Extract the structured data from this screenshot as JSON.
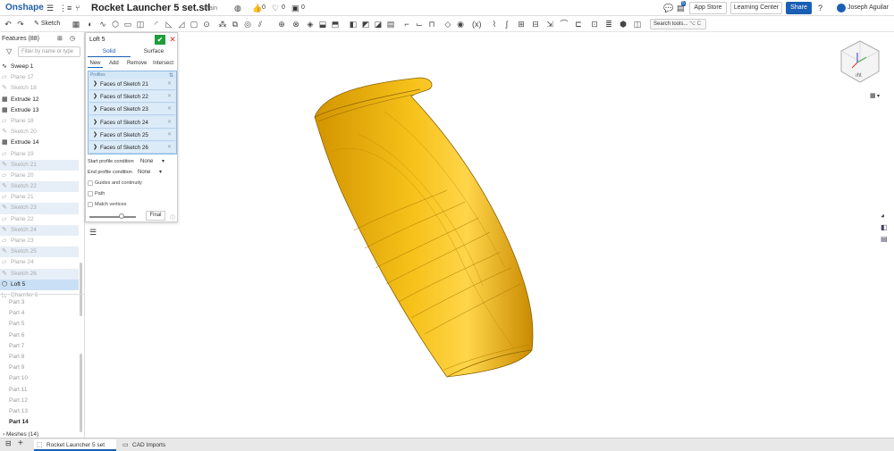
{
  "app": {
    "logo": "Onshape",
    "title": "Rocket Launcher 5 set.stl",
    "branch": "Main"
  },
  "header": {
    "likes": "0",
    "comments": "0",
    "doc_count": "0",
    "notif_count": "5",
    "app_store": "App Store",
    "learning_center": "Learning Center",
    "share": "Share",
    "user": "Joseph Aguilar",
    "help": "?"
  },
  "toolbar": {
    "sketch_label": "Sketch",
    "search_tools": "Search tools...",
    "shortcut": "⌥ C"
  },
  "features": {
    "title": "Features (88)",
    "filter_placeholder": "Filter by name or type",
    "items": [
      {
        "label": "Sweep 1",
        "icon": "sweep-icon",
        "state": "active"
      },
      {
        "label": "Plane 17",
        "icon": "plane-icon",
        "state": "dim"
      },
      {
        "label": "Sketch 18",
        "icon": "sketch-icon",
        "state": "dim"
      },
      {
        "label": "Extrude 12",
        "icon": "extrude-icon",
        "state": "active"
      },
      {
        "label": "Extrude 13",
        "icon": "extrude-icon",
        "state": "active"
      },
      {
        "label": "Plane 18",
        "icon": "plane-icon",
        "state": "dim"
      },
      {
        "label": "Sketch 20",
        "icon": "sketch-icon",
        "state": "dim"
      },
      {
        "label": "Extrude 14",
        "icon": "extrude-icon",
        "state": "active"
      },
      {
        "label": "Plane 19",
        "icon": "plane-icon",
        "state": "dim"
      },
      {
        "label": "Sketch 21",
        "icon": "sketch-icon",
        "state": "hl"
      },
      {
        "label": "Plane 20",
        "icon": "plane-icon",
        "state": "dim"
      },
      {
        "label": "Sketch 22",
        "icon": "sketch-icon",
        "state": "hl"
      },
      {
        "label": "Plane 21",
        "icon": "plane-icon",
        "state": "dim"
      },
      {
        "label": "Sketch 23",
        "icon": "sketch-icon",
        "state": "hl"
      },
      {
        "label": "Plane 22",
        "icon": "plane-icon",
        "state": "dim"
      },
      {
        "label": "Sketch 24",
        "icon": "sketch-icon",
        "state": "hl"
      },
      {
        "label": "Plane 23",
        "icon": "plane-icon",
        "state": "dim"
      },
      {
        "label": "Sketch 25",
        "icon": "sketch-icon",
        "state": "hl"
      },
      {
        "label": "Plane 24",
        "icon": "plane-icon",
        "state": "dim"
      },
      {
        "label": "Sketch 26",
        "icon": "sketch-icon",
        "state": "hl"
      },
      {
        "label": "Loft 5",
        "icon": "loft-icon",
        "state": "sel"
      },
      {
        "label": "Chamfer 6",
        "icon": "chamfer-icon",
        "state": "dim"
      }
    ],
    "parts": [
      "Part 3",
      "Part 4",
      "Part 5",
      "Part 6",
      "Part 7",
      "Part 8",
      "Part 9",
      "Part 10",
      "Part 11",
      "Part 12",
      "Part 13",
      "Part 14"
    ],
    "meshes": "Meshes (14)"
  },
  "loft": {
    "title": "Loft 5",
    "tabs": [
      "Solid",
      "Surface"
    ],
    "ops": [
      "New",
      "Add",
      "Remove",
      "Intersect"
    ],
    "profiles_label": "Profiles",
    "profiles": [
      "Faces of Sketch 21",
      "Faces of Sketch 22",
      "Faces of Sketch 23",
      "Faces of Sketch 24",
      "Faces of Sketch 25",
      "Faces of Sketch 26"
    ],
    "start_label": "Start profile condition",
    "start_value": "None",
    "end_label": "End profile condition",
    "end_value": "None",
    "options": [
      "Guides and continuity",
      "Path",
      "Match vertices"
    ],
    "final_label": "Final",
    "slider_value": 0.7
  },
  "tabs": {
    "part_studio": "Rocket Launcher 5 set",
    "cad_imports": "CAD Imports"
  },
  "colors": {
    "accent": "#1a5fb4",
    "model": "#f2b705",
    "ok": "#1f9d3a"
  }
}
